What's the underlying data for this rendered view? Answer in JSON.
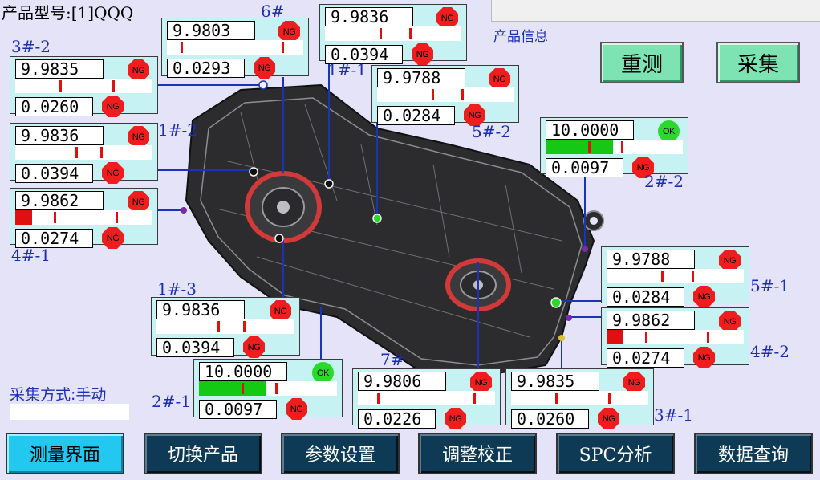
{
  "header": {
    "product_model": "产品型号:[1]QQQ",
    "info_label": "产品信息"
  },
  "actions": {
    "remeasure": "重测",
    "collect": "采集"
  },
  "collect_mode": "采集方式:手动",
  "colors": {
    "card_bg": "#c6f2f4",
    "ng": "#ef1d1d",
    "ok": "#2bd92b",
    "line": "#1a33b8",
    "nav": "#0e3a55",
    "nav_active": "#22c8ef"
  },
  "points": [
    {
      "id": "p6",
      "label": "6#",
      "value": "9.9803",
      "deviation": "0.0293",
      "status1": "NG",
      "status2": "NG",
      "fill": 0
    },
    {
      "id": "p1_1",
      "label": "1#-1",
      "value": "9.9836",
      "deviation": "0.0394",
      "status1": "NG",
      "status2": "NG",
      "fill": 0
    },
    {
      "id": "p3_2",
      "label": "3#-2",
      "value": "9.9835",
      "deviation": "0.0260",
      "status1": "NG",
      "status2": "NG",
      "fill": 0
    },
    {
      "id": "p5_2",
      "label": "5#-2",
      "value": "9.9788",
      "deviation": "0.0284",
      "status1": "NG",
      "status2": "NG",
      "fill": 0
    },
    {
      "id": "p1_2",
      "label": "1#-2",
      "value": "9.9836",
      "deviation": "0.0394",
      "status1": "NG",
      "status2": "NG",
      "fill": 0
    },
    {
      "id": "p2_2",
      "label": "2#-2",
      "value": "10.0000",
      "deviation": "0.0097",
      "status1": "OK",
      "status2": "NG",
      "fill": 0.49
    },
    {
      "id": "p4_1",
      "label": "4#-1",
      "value": "9.9862",
      "deviation": "0.0274",
      "status1": "NG",
      "status2": "NG",
      "fill": 0.12
    },
    {
      "id": "p5_1",
      "label": "5#-1",
      "value": "9.9788",
      "deviation": "0.0284",
      "status1": "NG",
      "status2": "NG",
      "fill": 0
    },
    {
      "id": "p1_3",
      "label": "1#-3",
      "value": "9.9836",
      "deviation": "0.0394",
      "status1": "NG",
      "status2": "NG",
      "fill": 0
    },
    {
      "id": "p4_2",
      "label": "4#-2",
      "value": "9.9862",
      "deviation": "0.0274",
      "status1": "NG",
      "status2": "NG",
      "fill": 0.12
    },
    {
      "id": "p2_1",
      "label": "2#-1",
      "value": "10.0000",
      "deviation": "0.0097",
      "status1": "OK",
      "status2": "NG",
      "fill": 0.49
    },
    {
      "id": "p7",
      "label": "7#",
      "value": "9.9806",
      "deviation": "0.0226",
      "status1": "NG",
      "status2": "NG",
      "fill": 0
    },
    {
      "id": "p3_1",
      "label": "3#-1",
      "value": "9.9835",
      "deviation": "0.0260",
      "status1": "NG",
      "status2": "NG",
      "fill": 0
    }
  ],
  "nav": [
    {
      "label": "测量界面",
      "active": true
    },
    {
      "label": "切换产品",
      "active": false
    },
    {
      "label": "参数设置",
      "active": false
    },
    {
      "label": "调整校正",
      "active": false
    },
    {
      "label": "SPC分析",
      "active": false
    },
    {
      "label": "数据查询",
      "active": false
    }
  ]
}
